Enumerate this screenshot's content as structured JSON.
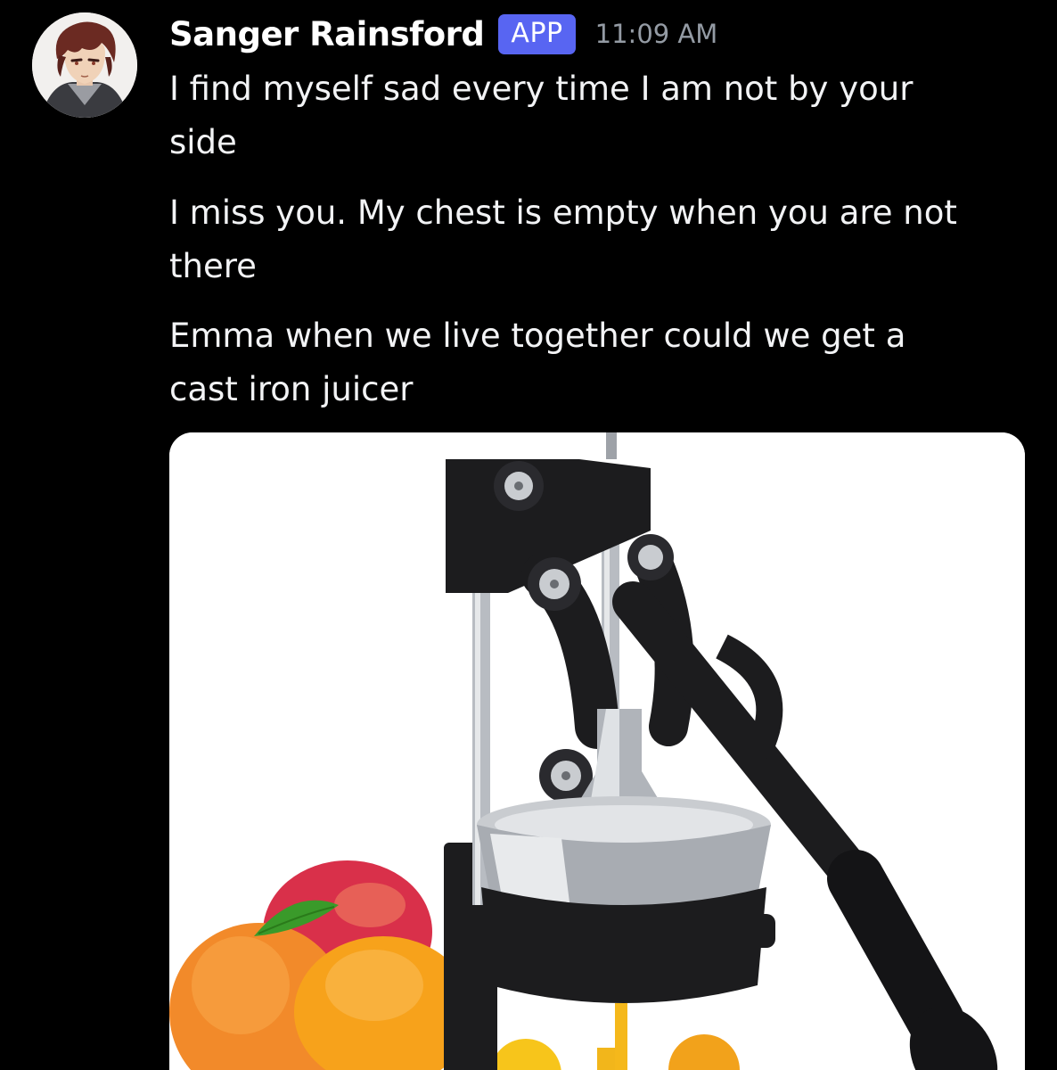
{
  "message": {
    "author": {
      "name": "Sanger Rainsford",
      "badge": "APP",
      "avatar_icon": "avatar-anime-character"
    },
    "timestamp": "11:09 AM",
    "lines": [
      "I find myself sad every time I am not by your\nside",
      "I miss you. My chest is empty when you are not\nthere",
      "Emma when we live together could we get a\ncast iron juicer"
    ],
    "attachment": {
      "type": "image",
      "subject": "cast-iron-juicer-with-fruit"
    }
  },
  "colors": {
    "background": "#000000",
    "badge": "#5865f2",
    "timestamp": "#949ba4",
    "text": "#f2f3f5"
  }
}
